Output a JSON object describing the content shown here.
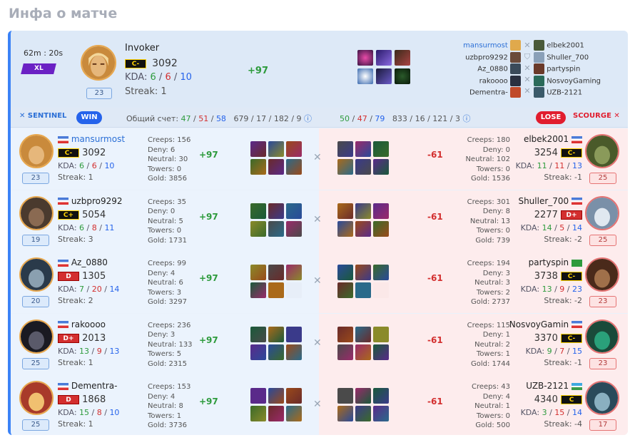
{
  "page_title": "Инфа о матче",
  "summary": {
    "duration": "62m : 20s",
    "badge": "XL",
    "hero_name": "Invoker",
    "rank": "C-",
    "rating": "3092",
    "kda_label": "KDA:",
    "k": "6",
    "d": "6",
    "a": "10",
    "streak": "Streak: 1",
    "level": "23",
    "delta": "+97",
    "roster_left": [
      "mansurmost",
      "uzbpro9292",
      "Az_0880",
      "rakoooo",
      "Dementra-"
    ],
    "roster_right": [
      "elbek2001",
      "Shuller_700",
      "partyspin",
      "NosvoyGaming",
      "UZB-2121"
    ]
  },
  "bar": {
    "sentinel": "SENTINEL",
    "win": "WIN",
    "score_label": "Общий счет:",
    "left_k": "47",
    "left_d": "51",
    "left_a": "58",
    "left_tot": "679 / 17 / 182 / 9",
    "right_k": "50",
    "right_d": "47",
    "right_a": "79",
    "right_tot": "833 / 16 / 121 / 3",
    "lose": "LOSE",
    "scourge": "SCOURGE"
  },
  "rows": [
    {
      "l": {
        "name": "mansurmost",
        "rank": "C-",
        "rating": "3092",
        "k": "6",
        "d": "6",
        "a": "10",
        "streak": "Streak: 1",
        "level": "23",
        "creeps": "Creeps: 156",
        "deny": "Deny: 6",
        "neutral": "Neutral: 30",
        "towers": "Towers: 0",
        "gold": "Gold: 3856",
        "delta": "+97"
      },
      "r": {
        "name": "elbek2001",
        "rank": "C-",
        "rating": "3254",
        "k": "11",
        "d": "11",
        "a": "13",
        "streak": "Streak: -1",
        "level": "25",
        "creeps": "Creeps: 180",
        "deny": "Deny: 0",
        "neutral": "Neutral: 102",
        "towers": "Towers: 0",
        "gold": "Gold: 1536",
        "delta": "-61"
      }
    },
    {
      "l": {
        "name": "uzbpro9292",
        "rank": "C+",
        "rating": "5054",
        "k": "6",
        "d": "8",
        "a": "11",
        "streak": "Streak: 3",
        "level": "19",
        "creeps": "Creeps: 35",
        "deny": "Deny: 0",
        "neutral": "Neutral: 5",
        "towers": "Towers: 0",
        "gold": "Gold: 1731",
        "delta": "+97"
      },
      "r": {
        "name": "Shuller_700",
        "rank": "D+",
        "rating": "2277",
        "k": "14",
        "d": "5",
        "a": "14",
        "streak": "Streak: -2",
        "level": "25",
        "creeps": "Creeps: 301",
        "deny": "Deny: 8",
        "neutral": "Neutral: 13",
        "towers": "Towers: 0",
        "gold": "Gold: 739",
        "delta": "-61"
      }
    },
    {
      "l": {
        "name": "Az_0880",
        "rank": "D",
        "rating": "1305",
        "k": "7",
        "d": "20",
        "a": "14",
        "streak": "Streak: 2",
        "level": "20",
        "creeps": "Creeps: 99",
        "deny": "Deny: 4",
        "neutral": "Neutral: 6",
        "towers": "Towers: 3",
        "gold": "Gold: 3297",
        "delta": "+97"
      },
      "r": {
        "name": "partyspin",
        "rank": "C-",
        "rating": "3738",
        "k": "13",
        "d": "9",
        "a": "23",
        "streak": "Streak: -2",
        "level": "23",
        "creeps": "Creeps: 194",
        "deny": "Deny: 3",
        "neutral": "Neutral: 3",
        "towers": "Towers: 2",
        "gold": "Gold: 2737",
        "delta": "-61"
      }
    },
    {
      "l": {
        "name": "rakoooo",
        "rank": "D+",
        "rating": "2013",
        "k": "13",
        "d": "9",
        "a": "13",
        "streak": "Streak: 1",
        "level": "25",
        "creeps": "Creeps: 236",
        "deny": "Deny: 3",
        "neutral": "Neutral: 133",
        "towers": "Towers: 5",
        "gold": "Gold: 2315",
        "delta": "+97"
      },
      "r": {
        "name": "NosvoyGamin",
        "rank": "C-",
        "rating": "3370",
        "k": "9",
        "d": "7",
        "a": "15",
        "streak": "Streak: -1",
        "level": "23",
        "creeps": "Creeps: 115",
        "deny": "Deny: 1",
        "neutral": "Neutral: 2",
        "towers": "Towers: 1",
        "gold": "Gold: 1744",
        "delta": "-61"
      }
    },
    {
      "l": {
        "name": "Dementra-",
        "rank": "D",
        "rating": "1868",
        "k": "15",
        "d": "8",
        "a": "10",
        "streak": "Streak: 1",
        "level": "25",
        "creeps": "Creeps: 153",
        "deny": "Deny: 4",
        "neutral": "Neutral: 8",
        "towers": "Towers: 1",
        "gold": "Gold: 3736",
        "delta": "+97"
      },
      "r": {
        "name": "UZB-2121",
        "rank": "C",
        "rating": "4340",
        "k": "3",
        "d": "15",
        "a": "14",
        "streak": "Streak: -4",
        "level": "17",
        "creeps": "Creeps: 43",
        "deny": "Deny: 4",
        "neutral": "Neutral: 1",
        "towers": "Towers: 0",
        "gold": "Gold: 500",
        "delta": "-61"
      }
    }
  ],
  "colors": {
    "accent": "#3b82f6",
    "win": "#2563eb",
    "lose": "#e11d2e",
    "positive": "#2e9b3d",
    "negative": "#d32f2f"
  }
}
